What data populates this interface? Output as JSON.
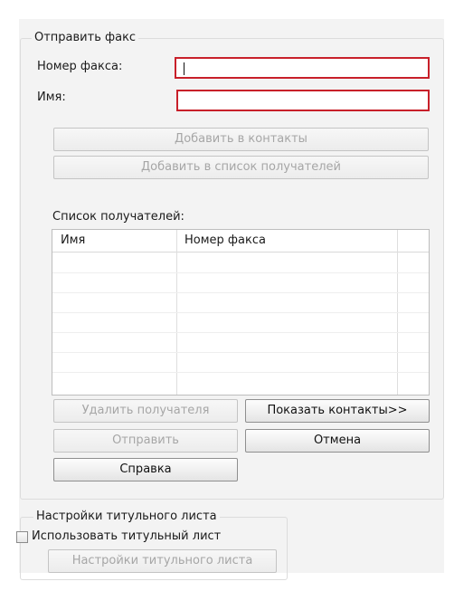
{
  "send_fax": {
    "legend": "Отправить факс",
    "fax_number_label": "Номер факса:",
    "fax_number_value": "",
    "name_label": "Имя:",
    "name_value": "",
    "add_to_contacts": "Добавить в контакты",
    "add_to_recipients": "Добавить в список получателей",
    "recipients_label": "Список получателей:",
    "table": {
      "columns": [
        "Имя",
        "Номер факса"
      ],
      "rows": []
    },
    "remove_recipient": "Удалить получателя",
    "show_contacts": "Показать контакты>>",
    "send": "Отправить",
    "cancel": "Отмена",
    "help": "Справка"
  },
  "cover_sheet": {
    "legend": "Настройки титульного листа",
    "use_cover_label": "Использовать титульный лист",
    "use_cover_checked": false,
    "settings_button": "Настройки титульного листа"
  },
  "colors": {
    "required_border": "#c8202a",
    "panel_bg": "#f3f3f3"
  }
}
